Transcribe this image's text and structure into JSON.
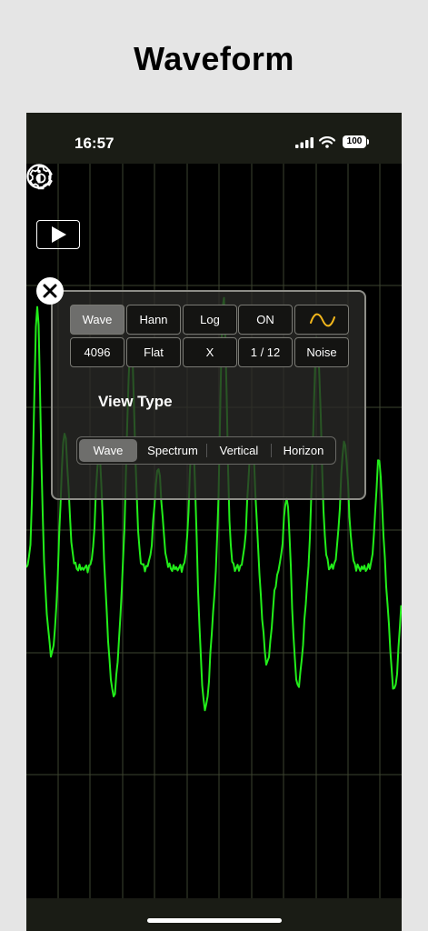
{
  "headline": "Waveform",
  "status_bar": {
    "time": "16:57",
    "battery": "100"
  },
  "settings_panel": {
    "row1": [
      "Wave",
      "Hann",
      "Log",
      "ON"
    ],
    "row1_icon": "sine-wave-icon",
    "row2": [
      "4096",
      "Flat",
      "X",
      "1 / 12",
      "Noise"
    ],
    "active_button": "Wave",
    "view_type_label": "View Type",
    "view_type_options": [
      "Wave",
      "Spectrum",
      "Vertical",
      "Horizon"
    ],
    "view_type_selected": "Wave"
  },
  "icons": {
    "play": "play-icon",
    "settings": "gear-icon",
    "info": "info-icon",
    "close": "close-icon"
  },
  "colors": {
    "trace": "#22ee1a",
    "grid": "#3d4430",
    "status_bar_bg": "#1a1c15",
    "sine_icon": "#f2b61c"
  }
}
